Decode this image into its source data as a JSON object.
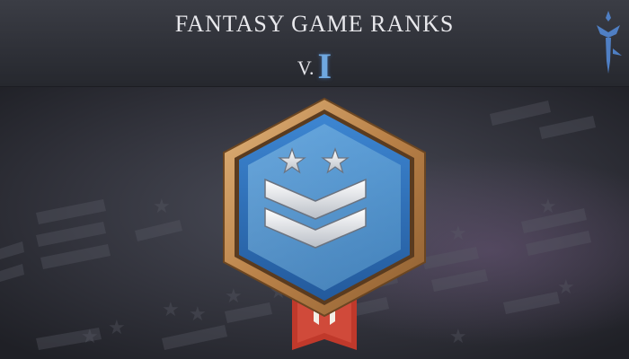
{
  "header": {
    "title": "FANTASY GAME RANKS",
    "version_prefix": "V.",
    "version_number": "I"
  },
  "badge": {
    "stars": 2,
    "chevrons": 2,
    "icon": "spartan-helmet-icon"
  },
  "logo": {
    "icon": "sword-emblem-icon"
  },
  "colors": {
    "hex_frame": "#c9955a",
    "hex_inner": "#2e6fb8",
    "chevron": "#d8dce2",
    "ribbon": "#c0392b",
    "title": "#e8e8ec",
    "version_accent": "#6fa8e0"
  }
}
